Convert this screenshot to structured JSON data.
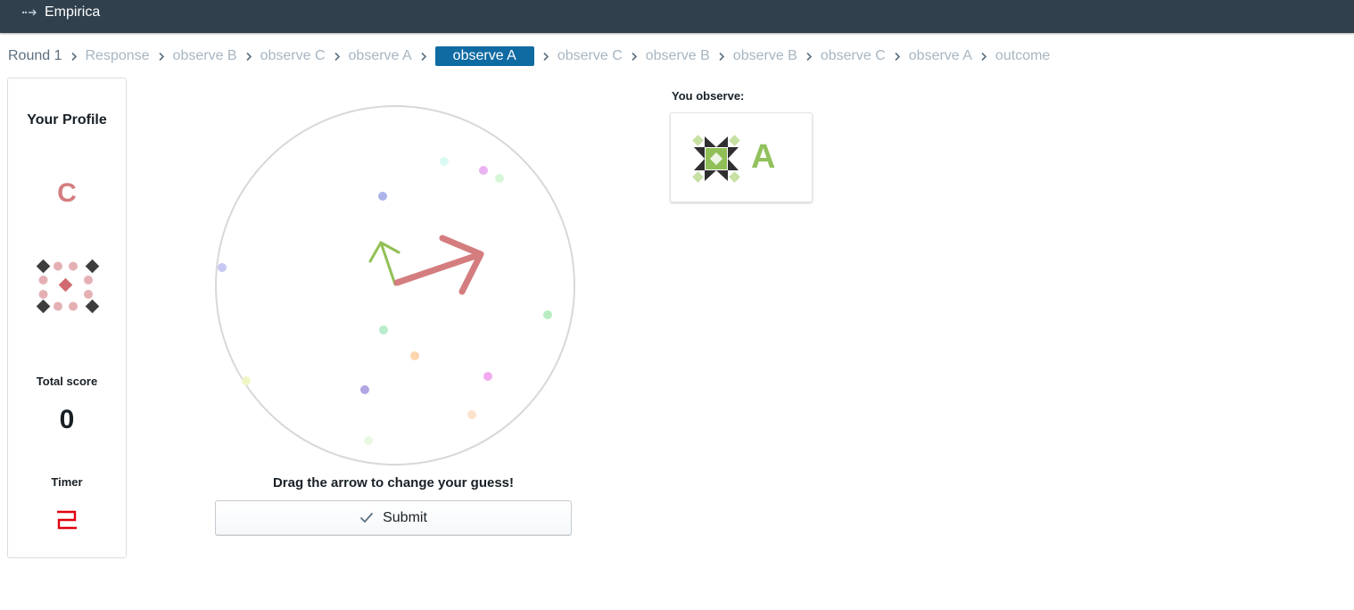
{
  "app": {
    "title": "Empirica"
  },
  "breadcrumbs": [
    {
      "label": "Round 1",
      "state": "first"
    },
    {
      "label": "Response",
      "state": "normal"
    },
    {
      "label": "observe B",
      "state": "normal"
    },
    {
      "label": "observe C",
      "state": "normal"
    },
    {
      "label": "observe A",
      "state": "normal"
    },
    {
      "label": "observe A",
      "state": "current"
    },
    {
      "label": "observe C",
      "state": "normal"
    },
    {
      "label": "observe B",
      "state": "normal"
    },
    {
      "label": "observe B",
      "state": "normal"
    },
    {
      "label": "observe C",
      "state": "normal"
    },
    {
      "label": "observe A",
      "state": "normal"
    },
    {
      "label": "outcome",
      "state": "normal"
    }
  ],
  "profile": {
    "title": "Your Profile",
    "letter": "C",
    "score_label": "Total score",
    "score_value": "0",
    "timer_label": "Timer",
    "timer_value": "2"
  },
  "main": {
    "instruction": "Drag the arrow to change your guess!",
    "submit_label": "Submit"
  },
  "observe": {
    "label": "You observe:",
    "letter": "A"
  },
  "colors": {
    "navbar": "#30404d",
    "active_crumb": "#106ba3",
    "profile_accent": "#d47d7f",
    "observe_accent": "#93c15e",
    "timer": "#e0000e"
  }
}
